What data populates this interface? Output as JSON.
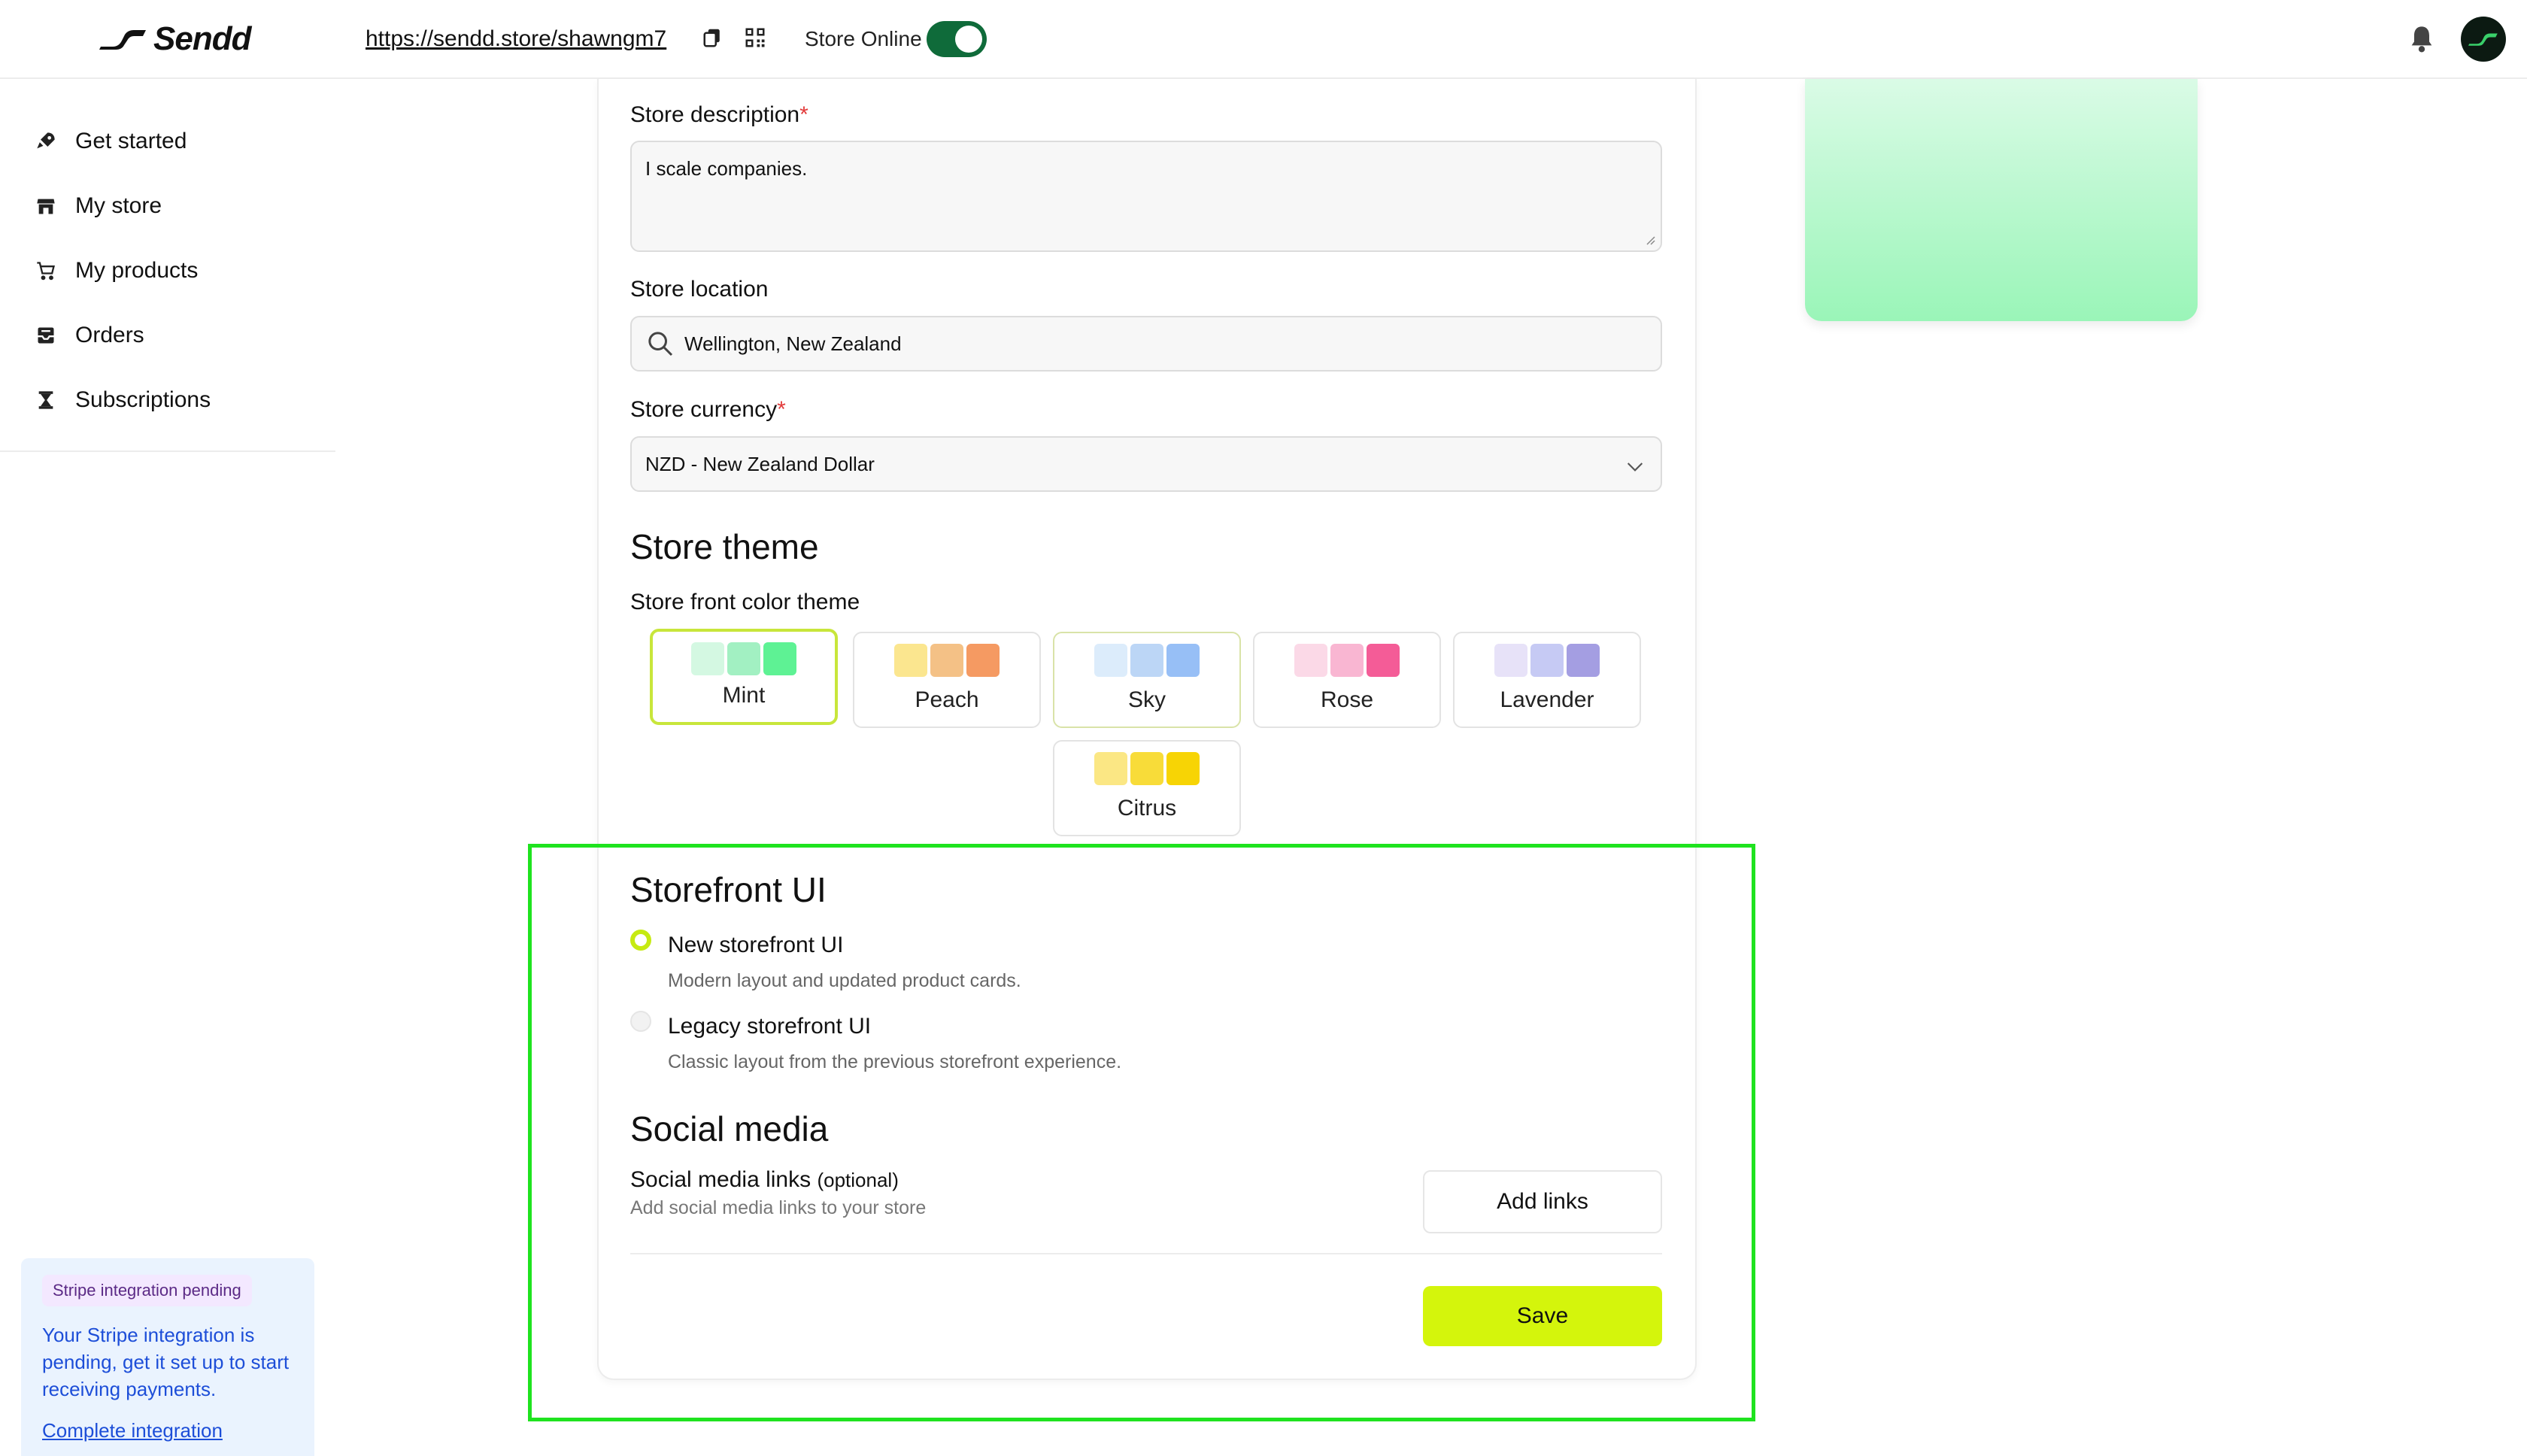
{
  "brand": {
    "name": "Sendd"
  },
  "topbar": {
    "store_url": "https://sendd.store/shawngm7",
    "store_online_label": "Store Online",
    "store_online": true
  },
  "sidebar": {
    "items": [
      {
        "label": "Get started",
        "icon": "rocket-icon"
      },
      {
        "label": "My store",
        "icon": "store-icon"
      },
      {
        "label": "My products",
        "icon": "cart-icon"
      },
      {
        "label": "Orders",
        "icon": "inbox-icon"
      },
      {
        "label": "Subscriptions",
        "icon": "hourglass-icon"
      }
    ],
    "stripe": {
      "badge": "Stripe integration pending",
      "text": "Your Stripe integration is pending, get it set up to start receiving payments.",
      "link": "Complete integration"
    }
  },
  "form": {
    "description": {
      "label": "Store description",
      "value": "I scale companies."
    },
    "location": {
      "label": "Store location",
      "value": "Wellington, New Zealand"
    },
    "currency": {
      "label": "Store currency",
      "value": "NZD - New Zealand Dollar"
    },
    "theme": {
      "title": "Store theme",
      "subtitle": "Store front color theme",
      "options": [
        {
          "label": "Mint",
          "colors": [
            "#d4f8e2",
            "#a2f0c2",
            "#5ef294"
          ],
          "selected": true
        },
        {
          "label": "Peach",
          "colors": [
            "#fbe68f",
            "#f4c186",
            "#f59a62"
          ]
        },
        {
          "label": "Sky",
          "colors": [
            "#dcecfb",
            "#bcd6f6",
            "#97bff6"
          ]
        },
        {
          "label": "Rose",
          "colors": [
            "#fbd9e7",
            "#f9b6d2",
            "#f45c97"
          ]
        },
        {
          "label": "Lavender",
          "colors": [
            "#e7e2f8",
            "#c6caf4",
            "#a49ee2"
          ]
        },
        {
          "label": "Citrus",
          "colors": [
            "#fbe784",
            "#f8dc39",
            "#f7d405"
          ]
        }
      ]
    },
    "storefront_ui": {
      "title": "Storefront UI",
      "options": [
        {
          "title": "New storefront UI",
          "desc": "Modern layout and updated product cards.",
          "checked": true
        },
        {
          "title": "Legacy storefront UI",
          "desc": "Classic layout from the previous storefront experience.",
          "checked": false
        }
      ]
    },
    "social": {
      "title": "Social media",
      "label": "Social media links",
      "optional": "(optional)",
      "desc": "Add social media links to your store",
      "add_button": "Add links"
    },
    "save_button": "Save"
  },
  "colors": {
    "accent": "#d4f50c",
    "toggle": "#0f6b3a",
    "highlight": "#1fe31f"
  }
}
